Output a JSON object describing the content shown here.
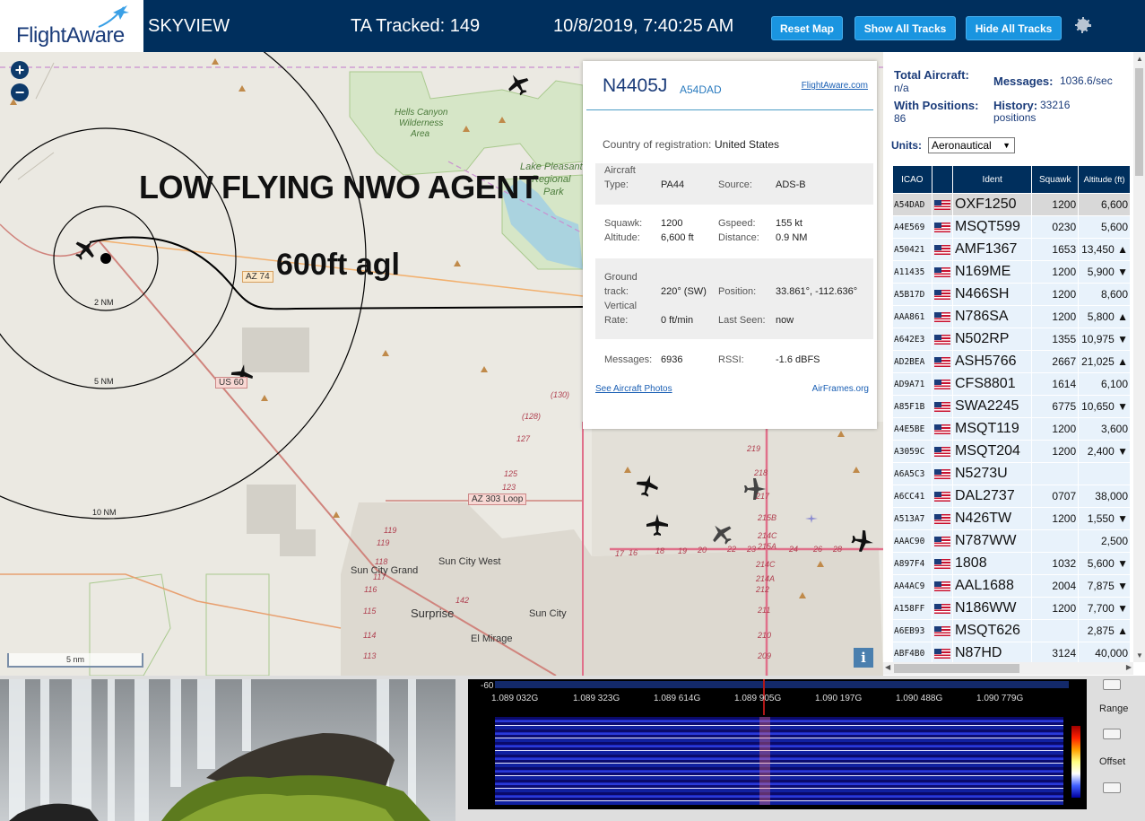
{
  "header": {
    "logo_text": "FlightAware",
    "app_name": "SKYVIEW",
    "tracked": "TA Tracked: 149",
    "datetime": "10/8/2019, 7:40:25 AM",
    "buttons": [
      "Reset Map",
      "Show All Tracks",
      "Hide All Tracks"
    ]
  },
  "map": {
    "zoom_in": "+",
    "zoom_out": "−",
    "overlay_title": "LOW FLYING NWO AGENT",
    "overlay_sub": "600ft agl",
    "range_rings": [
      "2 NM",
      "5 NM",
      "10 NM"
    ],
    "places": [
      "Hells Canyon",
      "Wilderness",
      "Area",
      "Lake Pleasant",
      "Regional",
      "Park",
      "Sun City Grand",
      "Sun City West",
      "Surprise",
      "Sun City",
      "El Mirage"
    ],
    "roads": [
      "AZ 74",
      "US 60",
      "AZ 303 Loop"
    ],
    "road_numbers": [
      "(130)",
      "(128)",
      "127",
      "125",
      "123",
      "119",
      "119",
      "118",
      "117",
      "116",
      "115",
      "114",
      "113",
      "142",
      "17",
      "16",
      "18",
      "19",
      "20",
      "22",
      "23",
      "24",
      "26",
      "28",
      "219",
      "218",
      "217",
      "215B",
      "214C",
      "215A",
      "214C",
      "214A",
      "212",
      "211",
      "210",
      "209"
    ],
    "scale": "5 nm",
    "info_btn": "i"
  },
  "popup": {
    "registration": "N4405J",
    "icao": "A54DAD",
    "link": "FlightAware.com",
    "country_label": "Country of registration:",
    "country": "United States",
    "aircraft_type_label": "Aircraft Type:",
    "aircraft_type_label_1": "Aircraft",
    "aircraft_type_label_2": "Type:",
    "aircraft_type": "PA44",
    "source_label": "Source:",
    "source": "ADS-B",
    "squawk_label": "Squawk:",
    "squawk": "1200",
    "gspeed_label": "Gspeed:",
    "gspeed": "155 kt",
    "altitude_label": "Altitude:",
    "altitude": "6,600 ft",
    "distance_label": "Distance:",
    "distance": "0.9 NM",
    "track_label_1": "Ground",
    "track_label_2": "track:",
    "track": "220° (SW)",
    "position_label": "Position:",
    "position": "33.861°, -112.636°",
    "vrate_label_1": "Vertical",
    "vrate_label_2": "Rate:",
    "vrate": "0 ft/min",
    "last_seen_label": "Last Seen:",
    "last_seen": "now",
    "messages_label": "Messages:",
    "messages": "6936",
    "rssi_label": "RSSI:",
    "rssi": "-1.6 dBFS",
    "photos_link": "See Aircraft Photos",
    "airframes_link": "AirFrames.org"
  },
  "sidebar": {
    "total_label": "Total Aircraft:",
    "total_value": "n/a",
    "messages_label": "Messages:",
    "messages_value": "1036.6/sec",
    "positions_label": "With Positions:",
    "positions_value": "86",
    "history_label": "History:",
    "history_value": "33216 positions",
    "units_label": "Units:",
    "units_value": "Aeronautical"
  },
  "table": {
    "headers": [
      "ICAO",
      "",
      "Ident",
      "Squawk",
      "Altitude (ft)"
    ],
    "rows": [
      [
        "A54DAD",
        "OXF1250",
        "1200",
        "6,600"
      ],
      [
        "A4E569",
        "MSQT599",
        "0230",
        "5,600"
      ],
      [
        "A50421",
        "AMF1367",
        "1653",
        "13,450 ▲"
      ],
      [
        "A11435",
        "N169ME",
        "1200",
        "5,900 ▼"
      ],
      [
        "A5B17D",
        "N466SH",
        "1200",
        "8,600"
      ],
      [
        "AAA861",
        "N786SA",
        "1200",
        "5,800 ▲"
      ],
      [
        "A642E3",
        "N502RP",
        "1355",
        "10,975 ▼"
      ],
      [
        "AD2BEA",
        "ASH5766",
        "2667",
        "21,025 ▲"
      ],
      [
        "AD9A71",
        "CFS8801",
        "1614",
        "6,100"
      ],
      [
        "A85F1B",
        "SWA2245",
        "6775",
        "10,650 ▼"
      ],
      [
        "A4E5BE",
        "MSQT119",
        "1200",
        "3,600"
      ],
      [
        "A3059C",
        "MSQT204",
        "1200",
        "2,400 ▼"
      ],
      [
        "A6A5C3",
        "N5273U",
        "",
        ""
      ],
      [
        "A6CC41",
        "DAL2737",
        "0707",
        "38,000"
      ],
      [
        "A513A7",
        "N426TW",
        "1200",
        "1,550 ▼"
      ],
      [
        "AAAC90",
        "N787WW",
        "",
        "2,500"
      ],
      [
        "A897F4",
        "1808",
        "1032",
        "5,600 ▼"
      ],
      [
        "AA4AC9",
        "AAL1688",
        "2004",
        "7,875 ▼"
      ],
      [
        "A158FF",
        "N186WW",
        "1200",
        "7,700 ▼"
      ],
      [
        "A6EB93",
        "MSQT626",
        "",
        "2,875 ▲"
      ],
      [
        "ABF4B0",
        "N87HD",
        "3124",
        "40,000"
      ]
    ]
  },
  "spectrum": {
    "level": "-60",
    "freqs": [
      "1.089 032G",
      "1.089 323G",
      "1.089 614G",
      "1.089 905G",
      "1.090 197G",
      "1.090 488G",
      "1.090 779G"
    ],
    "range_label": "Range",
    "offset_label": "Offset"
  }
}
